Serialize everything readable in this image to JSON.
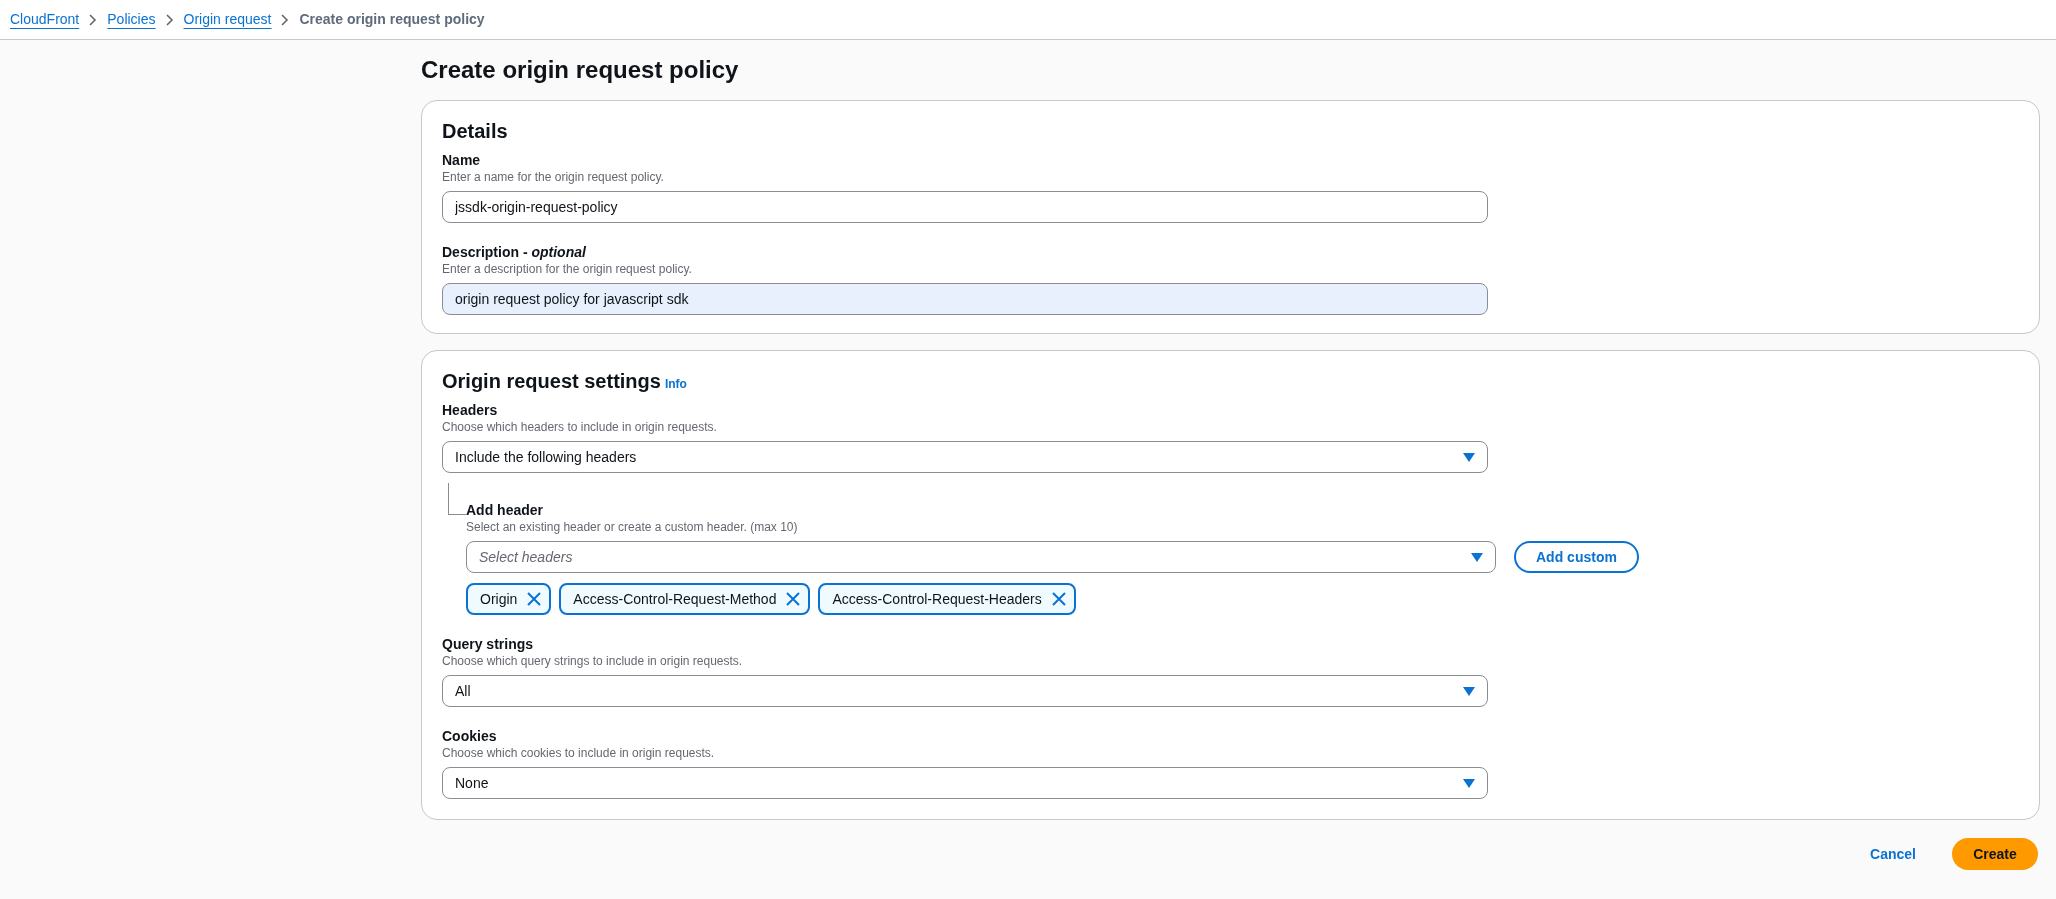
{
  "breadcrumbs": [
    {
      "label": "CloudFront",
      "link": true
    },
    {
      "label": "Policies",
      "link": true
    },
    {
      "label": "Origin request",
      "link": true
    },
    {
      "label": "Create origin request policy",
      "link": false
    }
  ],
  "page_title": "Create origin request policy",
  "details": {
    "title": "Details",
    "fields": [
      {
        "label": "Name",
        "hint": "Enter a name for the origin request policy.",
        "value": "jssdk-origin-request-policy",
        "focused": false
      },
      {
        "label": "Description - *optional*",
        "hint": "Enter a description for the origin request policy.",
        "value": "origin request policy for javascript sdk",
        "focused": true
      }
    ]
  },
  "settings": {
    "title": "Origin request settings",
    "info": "Info",
    "headers": {
      "label": "Headers",
      "hint": "Choose which headers to include in origin requests.",
      "value": "Include the following headers",
      "add_header": {
        "label": "Add header",
        "hint": "Select an existing header or create a custom header. (max 10)",
        "placeholder": "Select headers",
        "button": "Add custom",
        "tokens": [
          "Origin",
          "Access-Control-Request-Method",
          "Access-Control-Request-Headers"
        ]
      }
    },
    "selects": [
      {
        "label": "Query strings",
        "hint": "Choose which query strings to include in origin requests.",
        "value": "All"
      },
      {
        "label": "Cookies",
        "hint": "Choose which cookies to include in origin requests.",
        "value": "None"
      }
    ]
  },
  "actions": {
    "cancel": "Cancel",
    "create": "Create"
  }
}
